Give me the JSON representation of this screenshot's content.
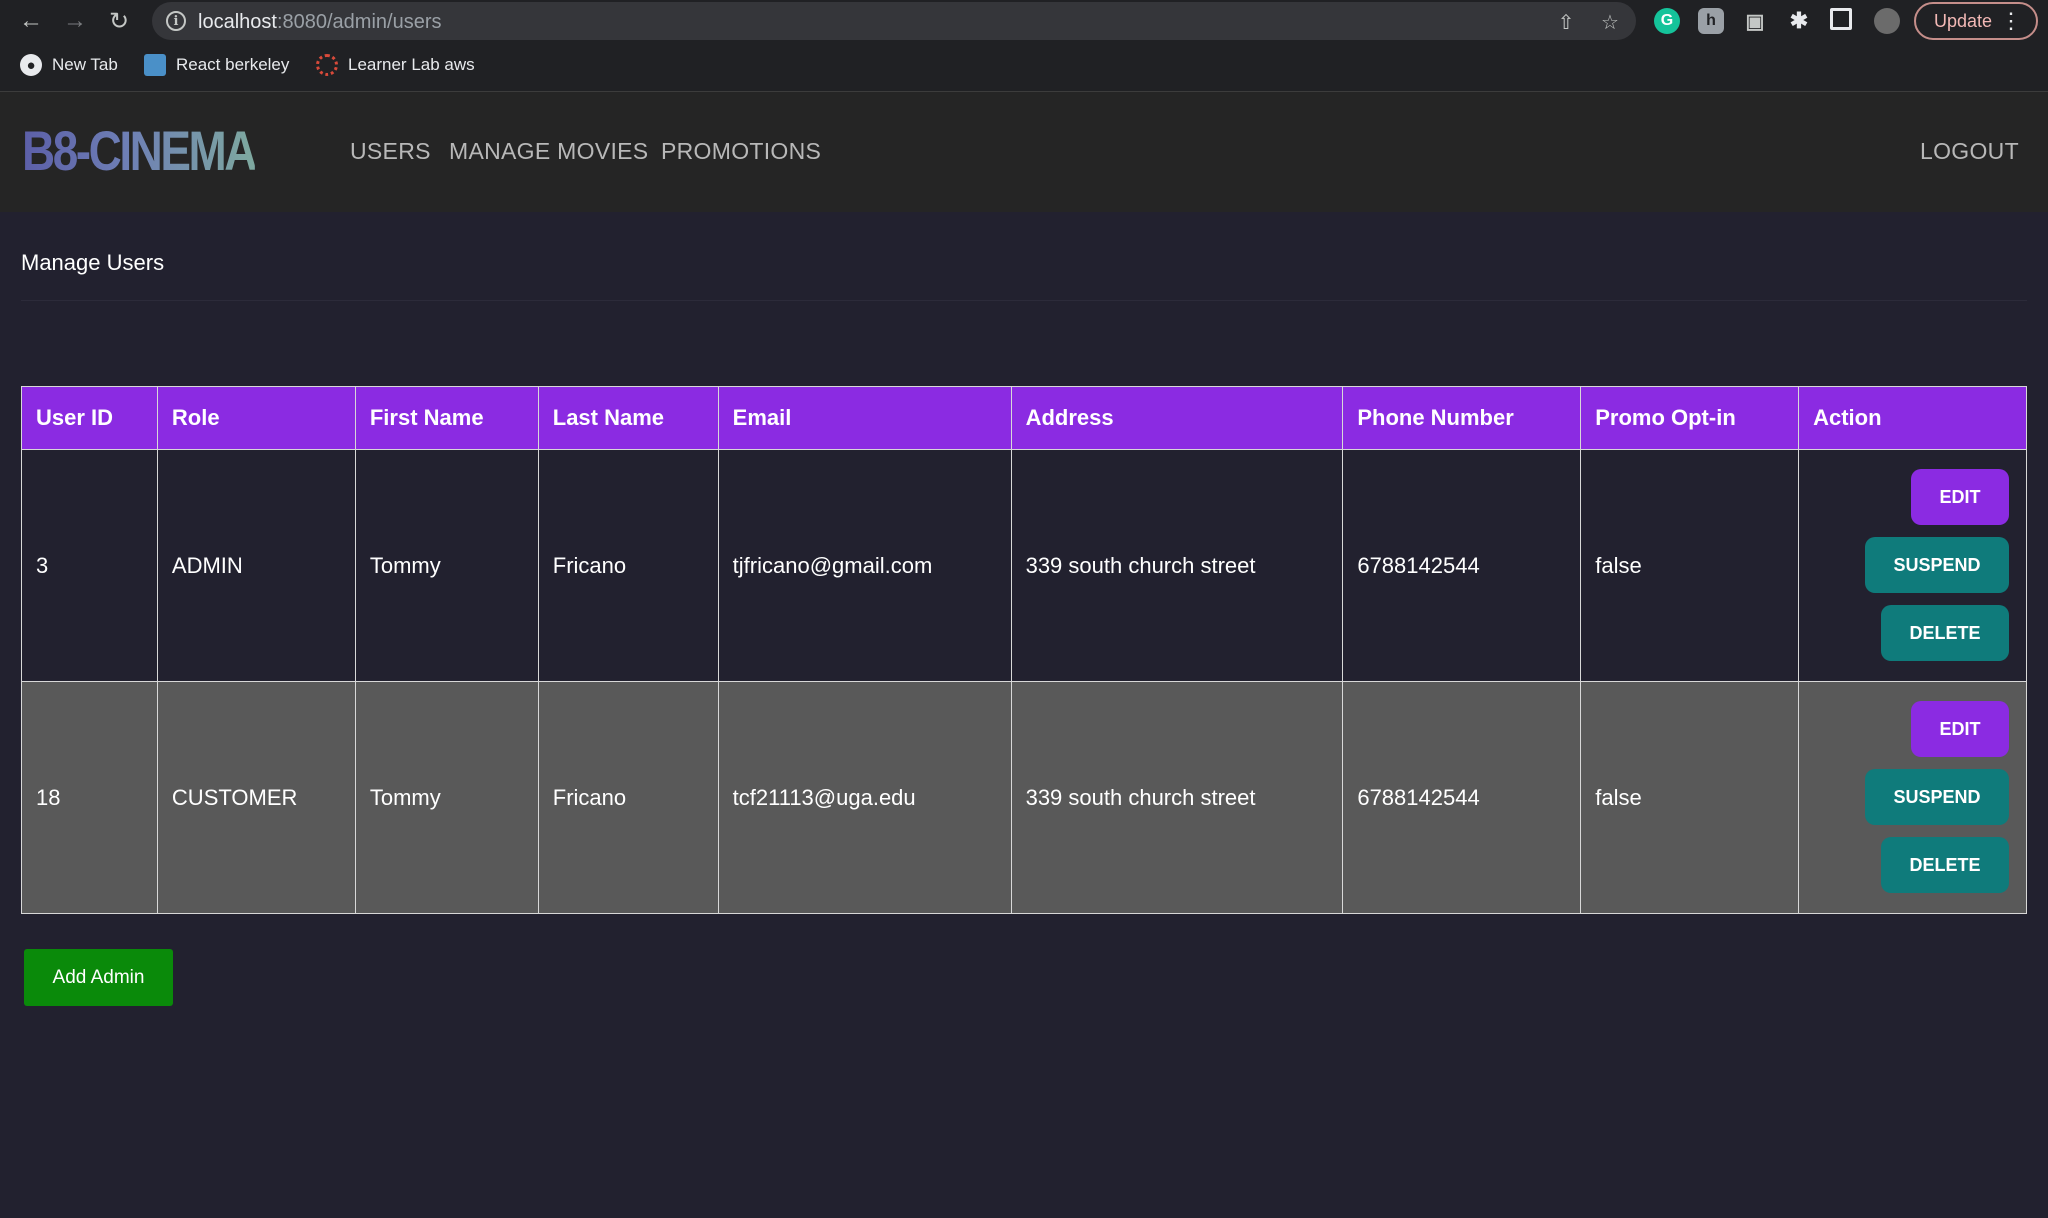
{
  "browser": {
    "url_host": "localhost",
    "url_path": ":8080/admin/users",
    "update_label": "Update",
    "bookmarks": [
      {
        "label": "New Tab",
        "icon": "globe-icon"
      },
      {
        "label": "React berkeley",
        "icon": "monitor-icon"
      },
      {
        "label": "Learner Lab aws",
        "icon": "canvas-icon"
      }
    ]
  },
  "header": {
    "logo": "B8-CINEMA",
    "nav": [
      "USERS",
      "MANAGE MOVIES",
      "PROMOTIONS"
    ],
    "logout": "LOGOUT"
  },
  "main": {
    "title": "Manage Users",
    "table": {
      "columns": [
        "User ID",
        "Role",
        "First Name",
        "Last Name",
        "Email",
        "Address",
        "Phone Number",
        "Promo Opt-in",
        "Action"
      ],
      "rows": [
        {
          "user_id": "3",
          "role": "ADMIN",
          "first_name": "Tommy",
          "last_name": "Fricano",
          "email": "tjfricano@gmail.com",
          "address": "339 south church street",
          "phone": "6788142544",
          "promo": "false"
        },
        {
          "user_id": "18",
          "role": "CUSTOMER",
          "first_name": "Tommy",
          "last_name": "Fricano",
          "email": "tcf21113@uga.edu",
          "address": "339 south church street",
          "phone": "6788142544",
          "promo": "false"
        }
      ],
      "actions": {
        "edit": "EDIT",
        "suspend": "SUSPEND",
        "delete": "DELETE"
      }
    },
    "add_admin": "Add Admin"
  },
  "colors": {
    "table_header": "#8b2be2",
    "edit_button": "#8b2be2",
    "teal_button": "#0f7b7b",
    "add_button": "#0a8a0a",
    "page_bg": "#22212f"
  }
}
